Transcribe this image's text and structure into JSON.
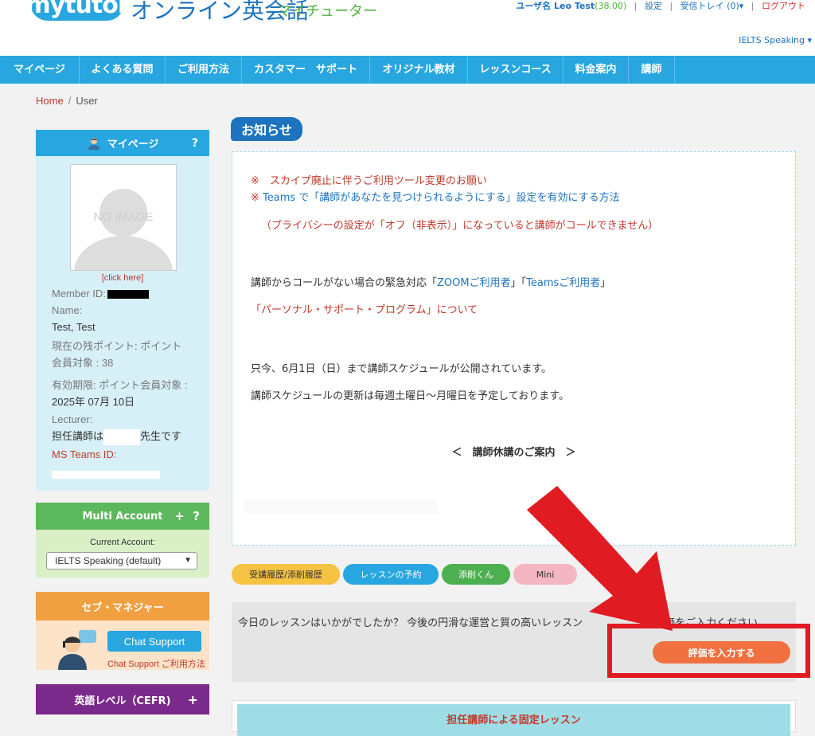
{
  "header": {
    "logo": "mytutor",
    "brand_jp": "オンライン英会話",
    "brand_sub": "マイチューター",
    "user_label": "ユーザ名 Leo Test",
    "points": "(38.00)",
    "settings": "設定",
    "inbox": "受信トレイ (0)",
    "inbox_caret": "▾",
    "logout": "ログアウト",
    "course": "IELTS Speaking",
    "course_caret": "▾"
  },
  "nav": {
    "items": [
      "マイページ",
      "よくある質問",
      "ご利用方法",
      "カスタマー　サポート",
      "オリジナル教材",
      "レッスンコース",
      "料金案内",
      "講師"
    ]
  },
  "breadcrumb": {
    "home": "Home",
    "sep": "/",
    "current": "User"
  },
  "profile": {
    "title": "マイページ",
    "help": "?",
    "no_image": "NO IMAGE",
    "click_here": "[click here]",
    "member_id_label": "Member ID:",
    "name_label": "Name:",
    "name_value": "Test, Test",
    "points_label": "現在の残ポイント: ポイント",
    "points_value": "会員対象 : 38",
    "expiry_label": "有効期限: ポイント会員対象 :",
    "expiry_value": "2025年 07月 10日",
    "lecturer_label": "Lecturer:",
    "lecturer_prefix": "担任講師は",
    "lecturer_suffix": "先生です",
    "teams_label": "MS Teams ID:"
  },
  "multi_account": {
    "title": "Multi Account",
    "plus": "+",
    "help": "?",
    "current_label": "Current Account:",
    "selected": "IELTS Speaking (default)"
  },
  "sebu": {
    "title": "セブ・マネジャー",
    "chat_button": "Chat Support",
    "chat_sub": "Chat Support ご利用方法"
  },
  "cefr": {
    "title": "英語レベル（CEFR)",
    "plus": "+"
  },
  "notice": {
    "tag": "お知らせ",
    "line1": "※　スカイプ廃止に伴うご利用ツール変更のお願い",
    "line2_mark": "※",
    "line2": "Teams で「講師があなたを見つけられるようにする」設定を有効にする方法",
    "line3": "（プライバシーの設定が「オフ（非表示）」になっていると講師がコールできません）",
    "line4_pre": "講師からコールがない場合の緊急対応「",
    "line4_zoom": "ZOOMご利用者",
    "line4_mid": "」「",
    "line4_teams": "Teamsご利用者",
    "line4_post": "」",
    "line5": "「パーソナル・サポート・プログラム」について",
    "line6": "只今、6月1日（日）まで講師スケジュールが公開されています。",
    "line7": "講師スケジュールの更新は毎週土曜日〜月曜日を予定しております。",
    "kyuko": "＜　講師休講のご案内　＞"
  },
  "pills": {
    "history": "受講履歴/添削履歴",
    "reserve": "レッスンの予約",
    "tensaku": "添削くん",
    "mini": "Mini"
  },
  "eval": {
    "text_left": "今日のレッスンはいかがでしたか？ 今後の円滑な運営と質の高いレッスン",
    "text_right": "評価をご入力ください。",
    "button": "評価を入力する"
  },
  "fixed_lesson": {
    "title": "担任講師による固定レッスン"
  },
  "colors": {
    "nav_blue": "#27a6df",
    "brand_blue": "#1e73be",
    "green": "#5cb85c",
    "orange": "#f0a040",
    "purple": "#7a2a8a",
    "annotation_red": "#e11b22",
    "eval_button": "#f07040"
  }
}
